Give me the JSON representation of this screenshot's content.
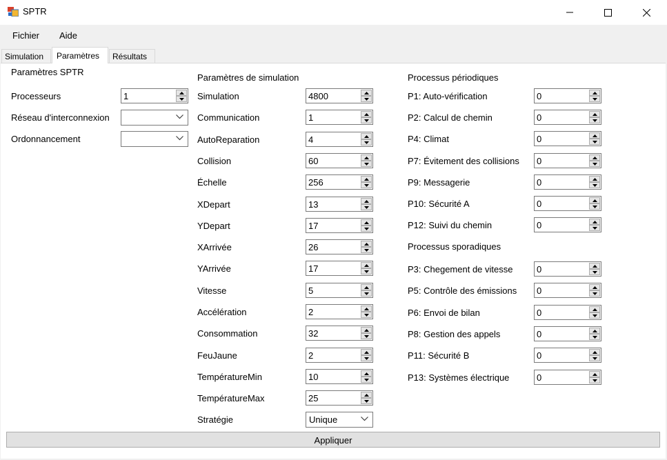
{
  "window": {
    "title": "SPTR"
  },
  "menu": {
    "items": [
      {
        "label": "Fichier"
      },
      {
        "label": "Aide"
      }
    ]
  },
  "tabs": [
    {
      "label": "Simulation"
    },
    {
      "label": "Paramètres",
      "active": true
    },
    {
      "label": "Résultats"
    }
  ],
  "sptr": {
    "heading": "Paramètres SPTR",
    "processeurs_label": "Processeurs",
    "processeurs_value": "1",
    "reseau_label": "Réseau d'interconnexion",
    "reseau_value": "",
    "ordonnancement_label": "Ordonnancement",
    "ordonnancement_value": ""
  },
  "simulation": {
    "heading": "Paramètres de simulation",
    "rows": [
      {
        "label": "Simulation",
        "value": "4800"
      },
      {
        "label": "Communication",
        "value": "1"
      },
      {
        "label": "AutoReparation",
        "value": "4"
      },
      {
        "label": "Collision",
        "value": "60"
      },
      {
        "label": "Échelle",
        "value": "256"
      },
      {
        "label": "XDepart",
        "value": "13"
      },
      {
        "label": "YDepart",
        "value": "17"
      },
      {
        "label": "XArrivée",
        "value": "26"
      },
      {
        "label": "YArrivée",
        "value": "17"
      },
      {
        "label": "Vitesse",
        "value": "5"
      },
      {
        "label": "Accélération",
        "value": "2"
      },
      {
        "label": "Consommation",
        "value": "32"
      },
      {
        "label": "FeuJaune",
        "value": "2"
      },
      {
        "label": "TempératureMin",
        "value": "10"
      },
      {
        "label": "TempératureMax",
        "value": "25"
      }
    ],
    "strategie_label": "Stratégie",
    "strategie_value": "Unique"
  },
  "periodiques": {
    "heading": "Processus périodiques",
    "rows": [
      {
        "label": "P1: Auto-vérification",
        "value": "0"
      },
      {
        "label": "P2: Calcul de chemin",
        "value": "0"
      },
      {
        "label": "P4: Climat",
        "value": "0"
      },
      {
        "label": "P7: Évitement des collisions",
        "value": "0"
      },
      {
        "label": "P9: Messagerie",
        "value": "0"
      },
      {
        "label": "P10: Sécurité A",
        "value": "0"
      },
      {
        "label": "P12: Suivi du chemin",
        "value": "0"
      }
    ]
  },
  "sporadiques": {
    "heading": "Processus sporadiques",
    "rows": [
      {
        "label": "P3: Chegement de vitesse",
        "value": "0"
      },
      {
        "label": "P5: Contrôle des émissions",
        "value": "0"
      },
      {
        "label": "P6: Envoi de bilan",
        "value": "0"
      },
      {
        "label": "P8: Gestion des appels",
        "value": "0"
      },
      {
        "label": "P11: Sécurité B",
        "value": "0"
      },
      {
        "label": "P13: Systèmes électrique",
        "value": "0"
      }
    ]
  },
  "apply_label": "Appliquer"
}
